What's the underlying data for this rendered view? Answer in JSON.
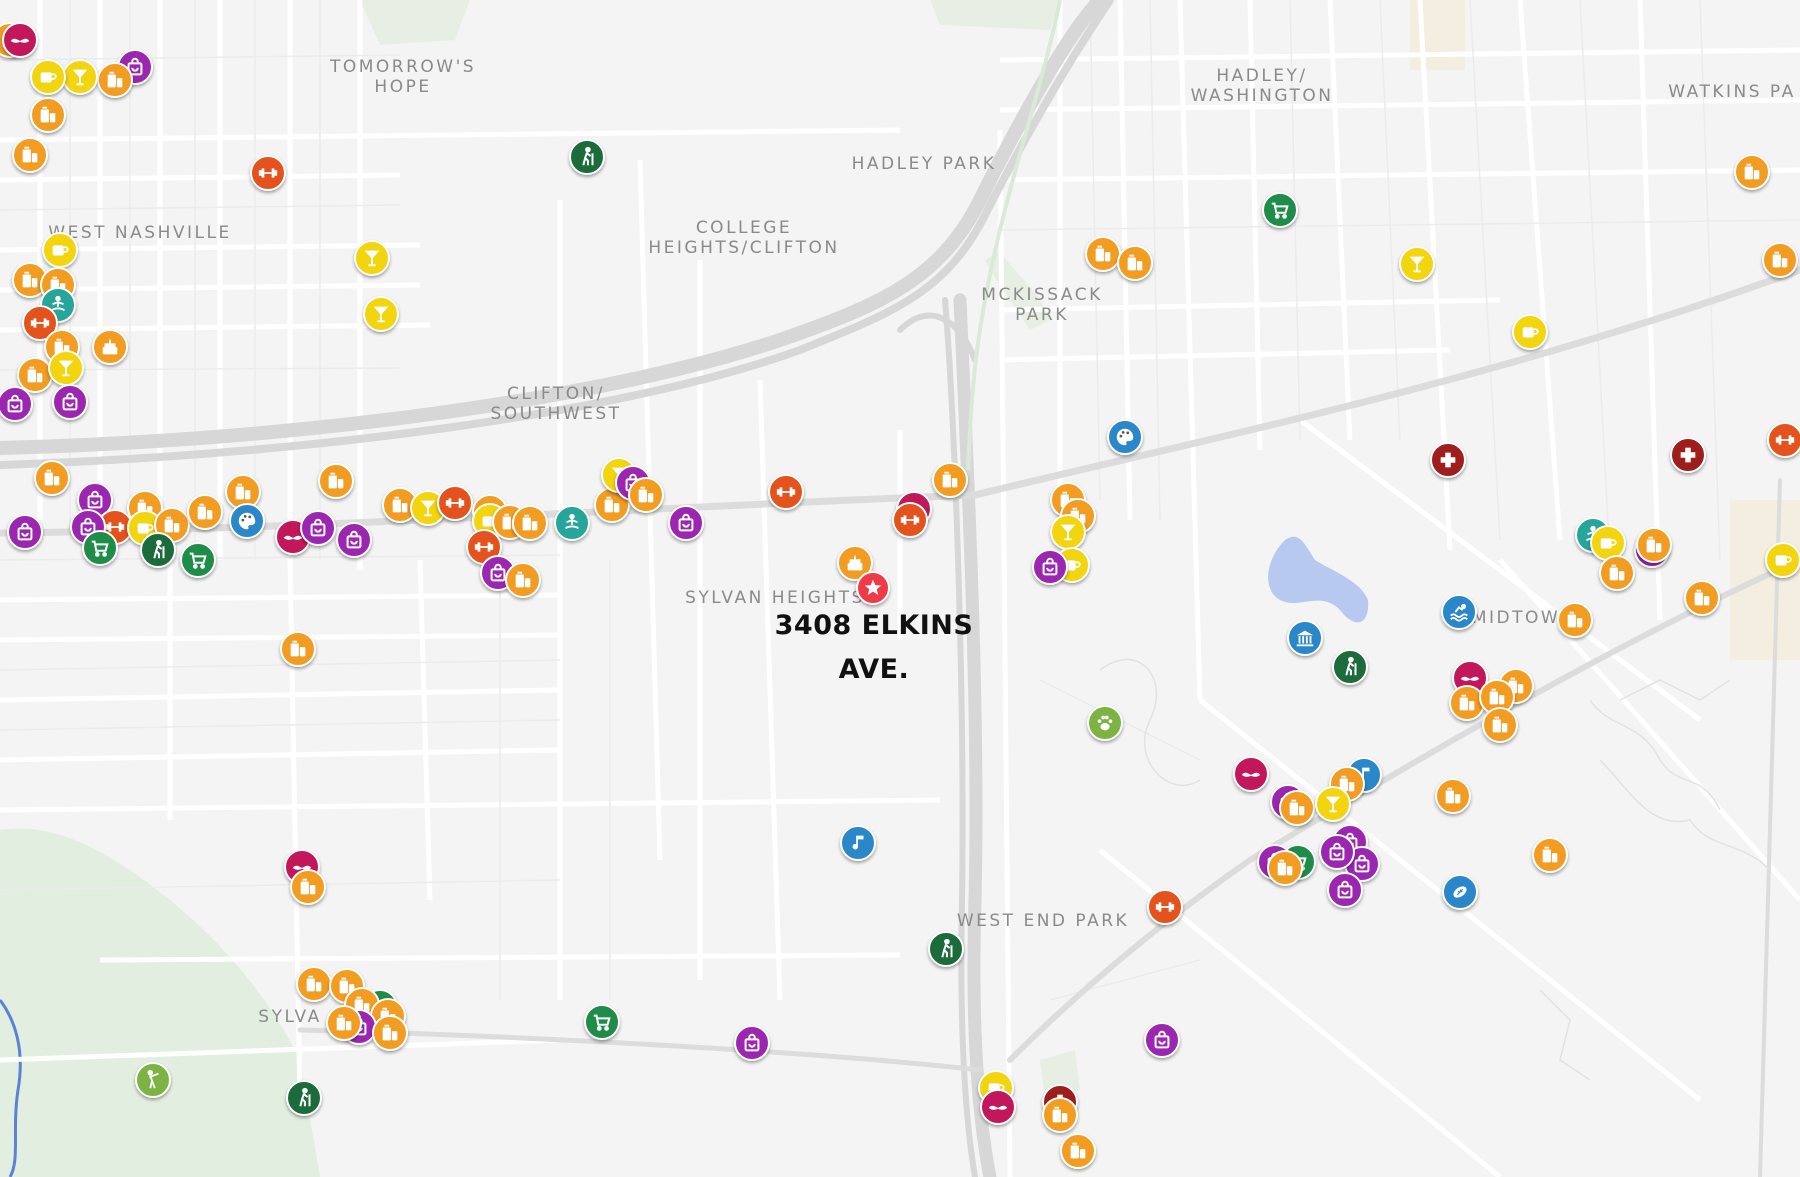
{
  "map": {
    "colors": {
      "background": "#f4f4f4",
      "roads": "#ffffff",
      "road_casing": "#e3e3e3",
      "freeway": "#d7d7d7",
      "park": "#e2eee0",
      "water": "#b8c9ef",
      "river": "#5a83d6",
      "label": "#8a8a8a"
    },
    "categories": {
      "restaurant": "#f39c22",
      "shopping": "#9b27b0",
      "bar": "#f2d40f",
      "coffee": "#f2d40f",
      "gym": "#e4531d",
      "grocery": "#1f8c4a",
      "hiking": "#1b6b3b",
      "yoga": "#26a69a",
      "art": "#2a87c9",
      "bakery": "#f39c22",
      "barber": "#c2185b",
      "medical": "#9e1d1d",
      "music": "#2a87c9",
      "pets": "#7cb342",
      "museum": "#2a87c9",
      "swimming": "#2a87c9",
      "sports": "#2a87c9",
      "golf": "#7cb342",
      "home": "#ef3b47"
    },
    "labels": [
      {
        "id": "tomorrows-hope",
        "text": "TOMORROW'S\nHOPE"
      },
      {
        "id": "hadley-washington",
        "text": "HADLEY/\nWASHINGTON"
      },
      {
        "id": "watkins-park",
        "text": "WATKINS PA"
      },
      {
        "id": "hadley-park",
        "text": "HADLEY PARK"
      },
      {
        "id": "college-heights",
        "text": "COLLEGE\nHEIGHTS/CLIFTON"
      },
      {
        "id": "west-nashville",
        "text": "WEST NASHVILLE"
      },
      {
        "id": "mckissack-park",
        "text": "MCKISSACK\nPARK"
      },
      {
        "id": "clifton-southwest",
        "text": "CLIFTON/\nSOUTHWEST"
      },
      {
        "id": "sylvan-heights",
        "text": "SYLVAN HEIGHTS"
      },
      {
        "id": "midtown",
        "text": "MIDTOW"
      },
      {
        "id": "west-end-park",
        "text": "WEST END PARK"
      },
      {
        "id": "sylvan-park",
        "text": "SYLVA"
      }
    ],
    "home": {
      "line1": "3408 ELKINS",
      "line2": "AVE.",
      "icon": "star-icon"
    }
  }
}
